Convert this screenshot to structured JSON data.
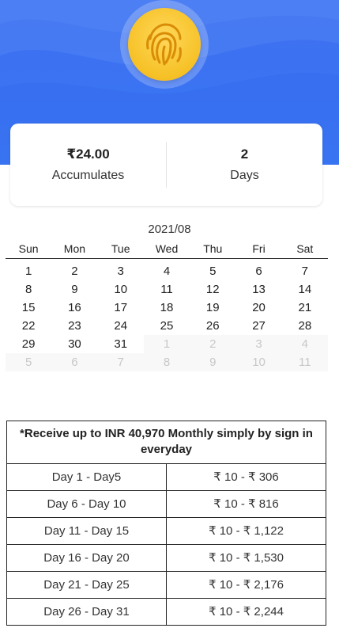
{
  "colors": {
    "hero_blue": "#3b74f2",
    "badge_gold": "#f6c126"
  },
  "badge": {
    "icon": "fingerprint-icon"
  },
  "stats": {
    "amount": "₹24.00",
    "amount_label": "Accumulates",
    "days": "2",
    "days_label": "Days"
  },
  "calendar": {
    "month": "2021/08",
    "weekdays": [
      "Sun",
      "Mon",
      "Tue",
      "Wed",
      "Thu",
      "Fri",
      "Sat"
    ],
    "weeks": [
      [
        "1",
        "2",
        "3",
        "4",
        "5",
        "6",
        "7"
      ],
      [
        "8",
        "9",
        "10",
        "11",
        "12",
        "13",
        "14"
      ],
      [
        "15",
        "16",
        "17",
        "18",
        "19",
        "20",
        "21"
      ],
      [
        "22",
        "23",
        "24",
        "25",
        "26",
        "27",
        "28"
      ],
      [
        "29",
        "30",
        "31",
        "1",
        "2",
        "3",
        "4"
      ],
      [
        "5",
        "6",
        "7",
        "8",
        "9",
        "10",
        "11"
      ]
    ],
    "outside": [
      [
        false,
        false,
        false,
        false,
        false,
        false,
        false
      ],
      [
        false,
        false,
        false,
        false,
        false,
        false,
        false
      ],
      [
        false,
        false,
        false,
        false,
        false,
        false,
        false
      ],
      [
        false,
        false,
        false,
        false,
        false,
        false,
        false
      ],
      [
        false,
        false,
        false,
        true,
        true,
        true,
        true
      ],
      [
        true,
        true,
        true,
        true,
        true,
        true,
        true
      ]
    ]
  },
  "reward": {
    "title": "*Receive up to INR 40,970 Monthly simply by sign in everyday",
    "rows": [
      {
        "days": "Day 1 - Day5",
        "amount": "₹ 10 - ₹ 306"
      },
      {
        "days": "Day 6 - Day 10",
        "amount": "₹ 10 - ₹ 816"
      },
      {
        "days": "Day 11 - Day 15",
        "amount": "₹ 10 - ₹ 1,122"
      },
      {
        "days": "Day 16 - Day 20",
        "amount": "₹ 10 - ₹ 1,530"
      },
      {
        "days": "Day 21 - Day 25",
        "amount": "₹ 10 - ₹ 2,176"
      },
      {
        "days": "Day 26 - Day 31",
        "amount": "₹ 10 - ₹ 2,244"
      }
    ]
  }
}
